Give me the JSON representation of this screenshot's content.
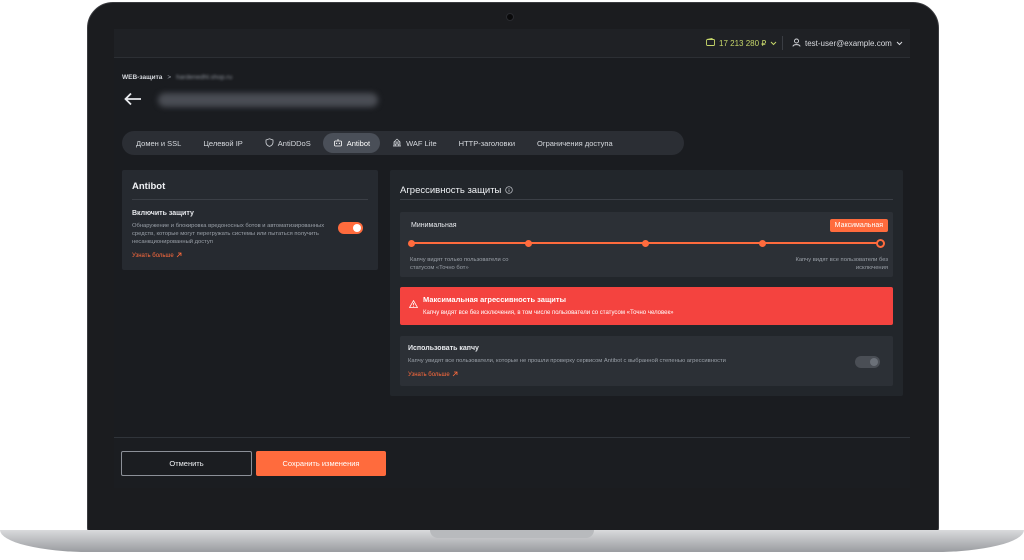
{
  "topbar": {
    "balance": "17 213 280 ₽",
    "user_email": "test-user@example.com",
    "accent_balance": "#c6d66a"
  },
  "breadcrumb": {
    "section": "WEB-защита",
    "separator": ">",
    "current": "hardenedhl.shop.ru"
  },
  "tabs": [
    {
      "label": "Домен и SSL",
      "icon": ""
    },
    {
      "label": "Целевой IP",
      "icon": ""
    },
    {
      "label": "AntiDDoS",
      "icon": "shield-icon"
    },
    {
      "label": "Antibot",
      "icon": "robot-icon",
      "active": true
    },
    {
      "label": "WAF Lite",
      "icon": "firewall-icon"
    },
    {
      "label": "HTTP-заголовки",
      "icon": ""
    },
    {
      "label": "Ограничения доступа",
      "icon": ""
    }
  ],
  "antibot": {
    "title": "Antibot",
    "enable_label": "Включить защиту",
    "description": "Обнаружение и блокировка вредоносных ботов и автоматизированных средств, которые могут перегружать системы или пытаться получить несанкционированный доступ",
    "learn_more": "Узнать больше",
    "enabled": true
  },
  "aggressiveness": {
    "title": "Агрессивность защиты",
    "min_label": "Минимальная",
    "max_label": "Максимальная",
    "levels": 5,
    "selected_level": 5,
    "left_hint": "Капчу видят только пользователи со статусом «Точно бот»",
    "right_hint": "Капчу видят все пользователи без исключения"
  },
  "alert": {
    "title": "Максимальная агрессивность защиты",
    "text": "Капчу видят все без исключения, в том числе пользователи со статусом «Точно человек»",
    "color": "#f4433f"
  },
  "captcha": {
    "title": "Использовать капчу",
    "description": "Капчу увидят все пользователи, которые не прошли проверку сервисом Antibot с выбранной степенью агрессивности",
    "learn_more": "Узнать больше",
    "enabled": false
  },
  "footer": {
    "cancel_label": "Отменить",
    "save_label": "Сохранить изменения"
  },
  "colors": {
    "accent": "#ff6b3d",
    "background": "#1a1c20",
    "panel": "#262a30"
  }
}
